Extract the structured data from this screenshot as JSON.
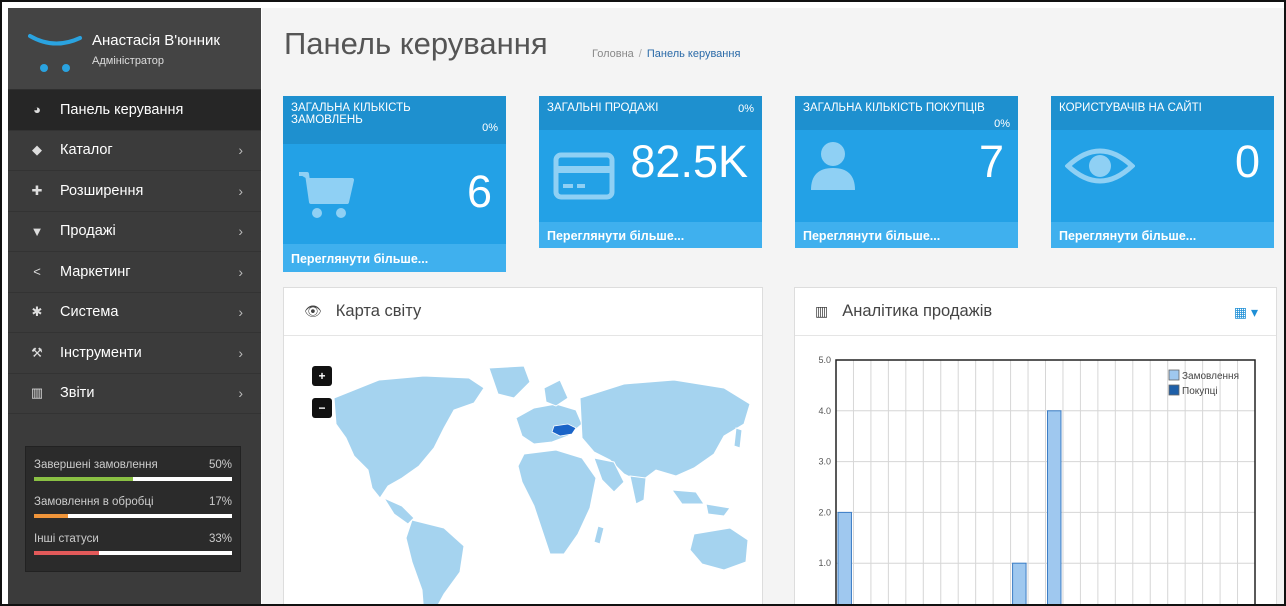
{
  "user": {
    "name": "Анастасія В'юнник",
    "role": "Адміністратор"
  },
  "menu": [
    {
      "label": "Панель керування",
      "icon": "dashboard-icon",
      "glyph": "◕",
      "active": true,
      "chevron": ""
    },
    {
      "label": "Каталог",
      "icon": "tag-icon",
      "glyph": "◆",
      "active": false,
      "chevron": "›"
    },
    {
      "label": "Розширення",
      "icon": "puzzle-icon",
      "glyph": "✚",
      "active": false,
      "chevron": "›"
    },
    {
      "label": "Продажі",
      "icon": "cart-icon",
      "glyph": "▼",
      "active": false,
      "chevron": "›"
    },
    {
      "label": "Маркетинг",
      "icon": "share-icon",
      "glyph": "<",
      "active": false,
      "chevron": "›"
    },
    {
      "label": "Система",
      "icon": "gear-icon",
      "glyph": "✱",
      "active": false,
      "chevron": "›"
    },
    {
      "label": "Інструменти",
      "icon": "wrench-icon",
      "glyph": "⚒",
      "active": false,
      "chevron": "›"
    },
    {
      "label": "Звіти",
      "icon": "bar-chart-icon",
      "glyph": "▥",
      "active": false,
      "chevron": "›"
    }
  ],
  "order_status": [
    {
      "label": "Завершені замовлення",
      "percent": "50%",
      "value": 0.5,
      "color": "#8ac044"
    },
    {
      "label": "Замовлення в обробці",
      "percent": "17%",
      "value": 0.17,
      "color": "#f0953a"
    },
    {
      "label": "Інші статуси",
      "percent": "33%",
      "value": 0.33,
      "color": "#e35a5a"
    }
  ],
  "header": {
    "title": "Панель керування",
    "breadcrumb_home": "Головна",
    "breadcrumb_sep": "/",
    "breadcrumb_current": "Панель керування"
  },
  "tiles": [
    {
      "title": "ЗАГАЛЬНА КІЛЬКІСТЬ ЗАМОВЛЕНЬ",
      "percent": "0%",
      "value": "6",
      "link": "Переглянути більше...",
      "icon": "cart-icon"
    },
    {
      "title": "ЗАГАЛЬНІ ПРОДАЖІ",
      "percent": "0%",
      "value": "82.5K",
      "link": "Переглянути більше...",
      "icon": "credit-card-icon"
    },
    {
      "title": "ЗАГАЛЬНА КІЛЬКІСТЬ ПОКУПЦІВ",
      "percent": "0%",
      "value": "7",
      "link": "Переглянути більше...",
      "icon": "user-icon"
    },
    {
      "title": "КОРИСТУВАЧІВ НА САЙТІ",
      "percent": "",
      "value": "0",
      "link": "Переглянути більше...",
      "icon": "eye-icon"
    }
  ],
  "map_panel": {
    "title": "Карта світу",
    "zoom_in": "+",
    "zoom_out": "−",
    "highlight_color": "#1a64c8",
    "land_color": "#a5d3ef"
  },
  "sales_panel": {
    "title": "Аналітика продажів"
  },
  "colors": {
    "sidebar": "#3b3b3b",
    "tile": "#23a1e6",
    "tile_head": "#1e90cf",
    "tile_foot": "#3fb0ee"
  },
  "chart_data": {
    "type": "bar",
    "ylim": [
      0,
      5
    ],
    "y_ticks": [
      "0.0",
      "1.0",
      "2.0",
      "3.0",
      "4.0",
      "5.0"
    ],
    "series": [
      {
        "name": "Замовлення",
        "color": "#9fc8ef",
        "values": [
          2,
          0,
          0,
          0,
          0,
          0,
          0,
          0,
          0,
          0,
          1,
          0,
          4,
          0,
          0,
          0,
          0,
          0,
          0,
          0,
          0,
          0,
          0,
          0
        ]
      },
      {
        "name": "Покупці",
        "color": "#1e5fa8",
        "values": [
          0,
          0,
          0,
          0,
          0,
          0,
          0,
          0,
          0,
          0,
          0,
          0,
          0,
          0,
          0,
          0,
          0,
          0,
          0,
          0,
          0,
          0,
          0,
          0
        ]
      }
    ],
    "grid": true,
    "legend": "top-right"
  }
}
